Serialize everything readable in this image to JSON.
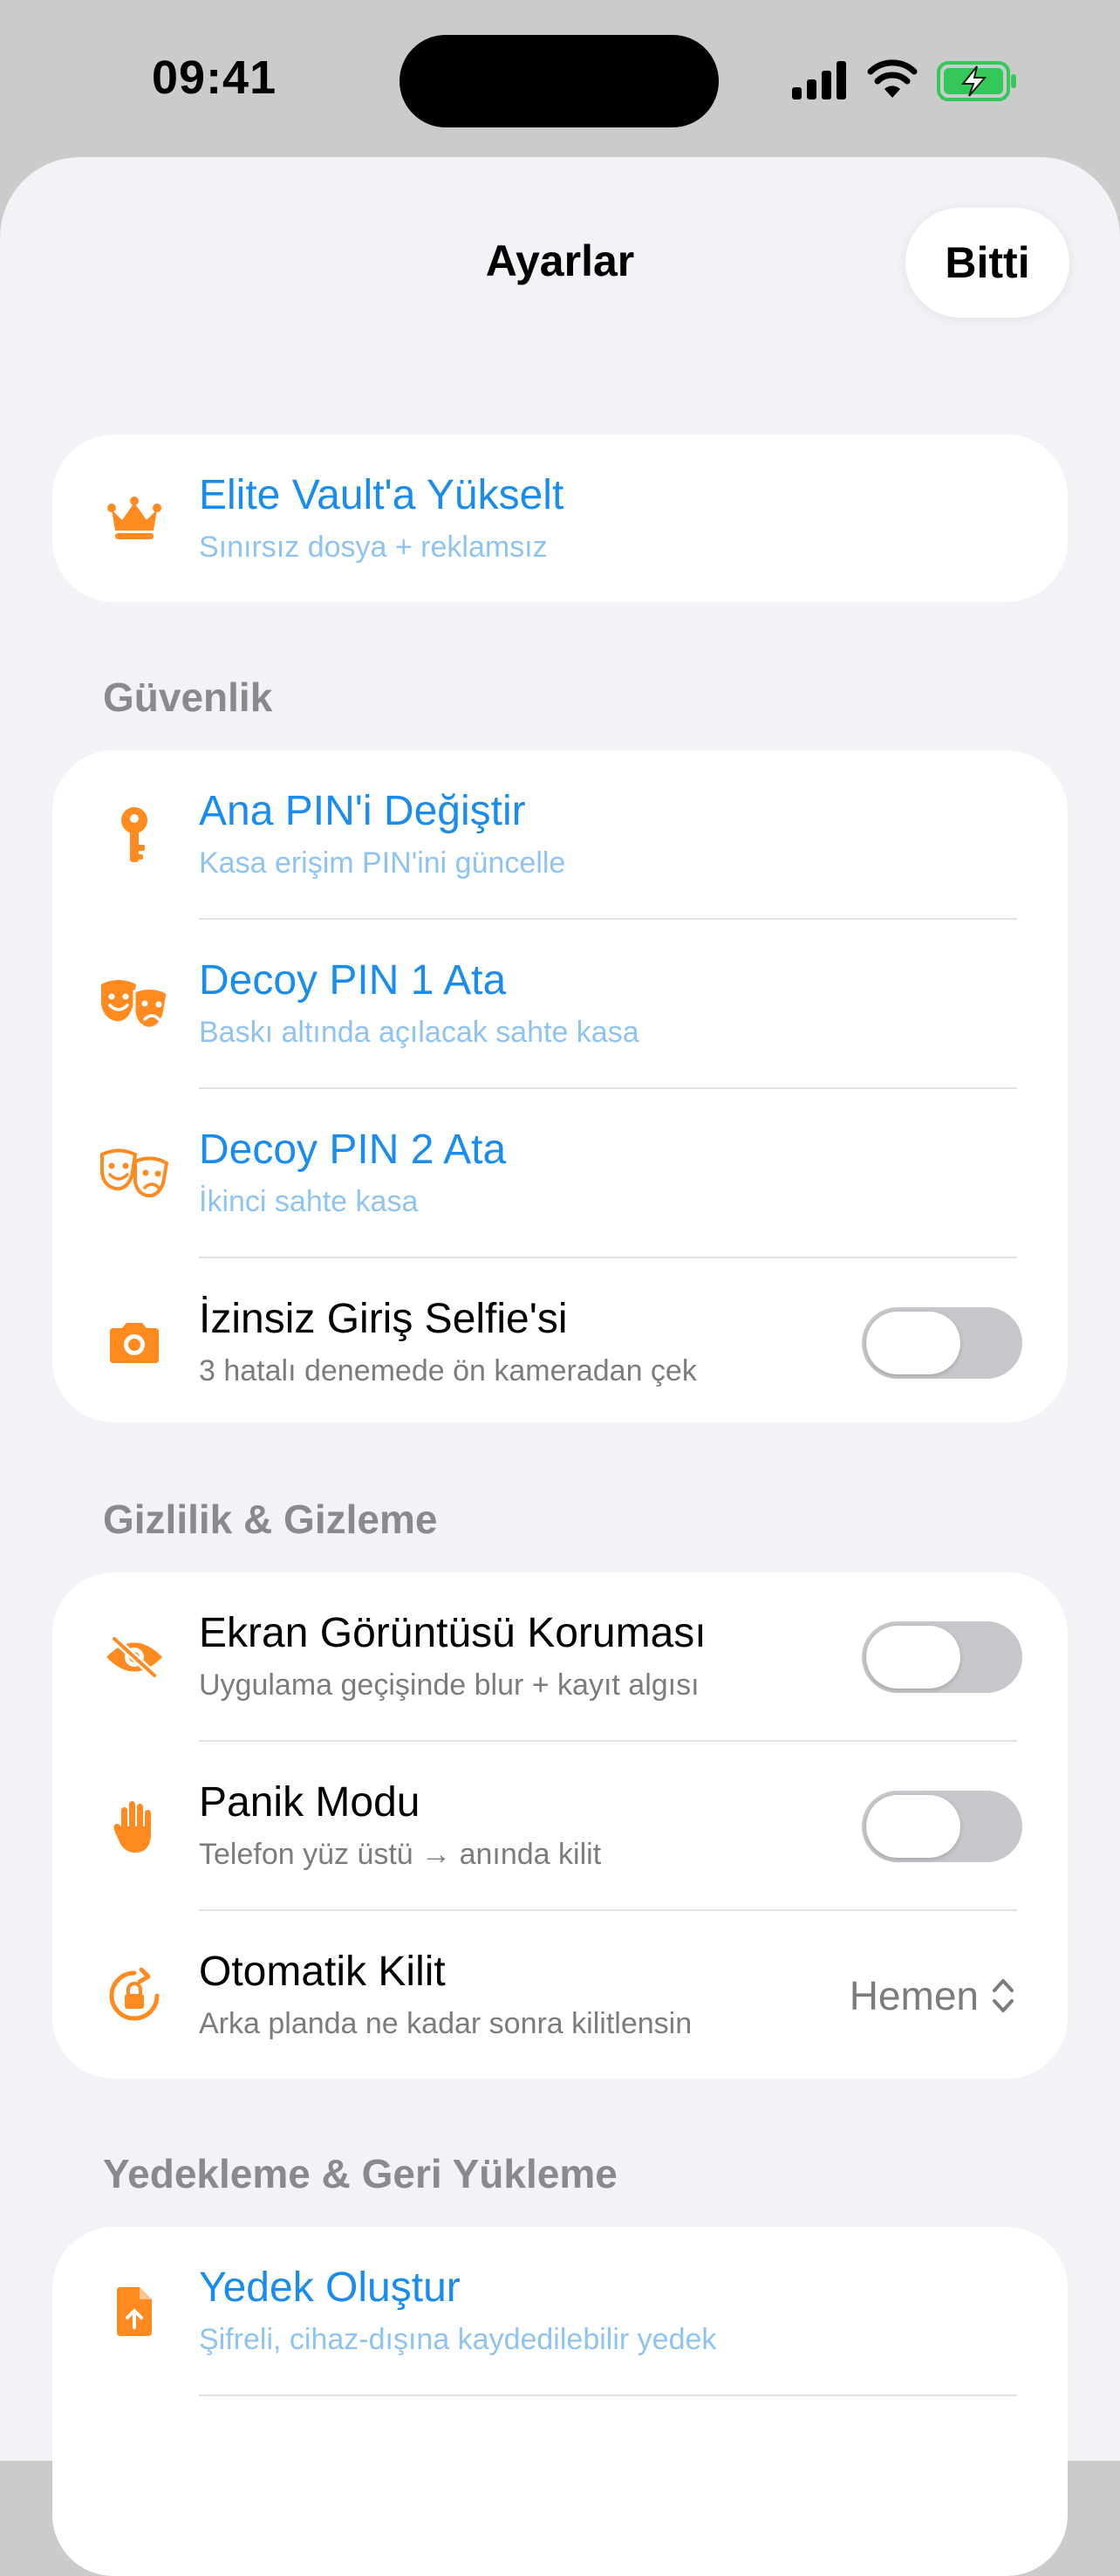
{
  "status_bar": {
    "time": "09:41"
  },
  "nav": {
    "title": "Ayarlar",
    "done_label": "Bitti"
  },
  "colors": {
    "accent_orange": "#ff8a1f",
    "link_blue": "#1a8cf0",
    "toggle_off": "#c7c7cc"
  },
  "upgrade": {
    "title": "Elite Vault'a Yükselt",
    "subtitle": "Sınırsız dosya + reklamsız",
    "icon": "crown-icon"
  },
  "security": {
    "header": "Güvenlik",
    "items": [
      {
        "title": "Ana PIN'i Değiştir",
        "subtitle": "Kasa erişim PIN'ini güncelle",
        "icon": "key-icon"
      },
      {
        "title": "Decoy PIN 1 Ata",
        "subtitle": "Baskı altında açılacak sahte kasa",
        "icon": "theater-masks-icon"
      },
      {
        "title": "Decoy PIN 2 Ata",
        "subtitle": "İkinci sahte kasa",
        "icon": "theater-masks-outline-icon"
      },
      {
        "title": "İzinsiz Giriş Selfie'si",
        "subtitle": "3 hatalı denemede ön kameradan çek",
        "icon": "camera-icon",
        "toggle": false
      }
    ]
  },
  "privacy": {
    "header": "Gizlilik & Gizleme",
    "items": [
      {
        "title": "Ekran Görüntüsü Koruması",
        "subtitle": "Uygulama geçişinde blur + kayıt algısı",
        "icon": "eye-slash-icon",
        "toggle": false
      },
      {
        "title": "Panik Modu",
        "subtitle": "Telefon yüz üstü → anında kilit",
        "icon": "hand-icon",
        "toggle": false
      },
      {
        "title": "Otomatik Kilit",
        "subtitle": "Arka planda ne kadar sonra kilitlensin",
        "icon": "lock-rotation-icon",
        "value": "Hemen"
      }
    ]
  },
  "backup": {
    "header": "Yedekleme & Geri Yükleme",
    "items": [
      {
        "title": "Yedek Oluştur",
        "subtitle": "Şifreli, cihaz-dışına kaydedilebilir yedek",
        "icon": "document-upload-icon"
      }
    ]
  }
}
